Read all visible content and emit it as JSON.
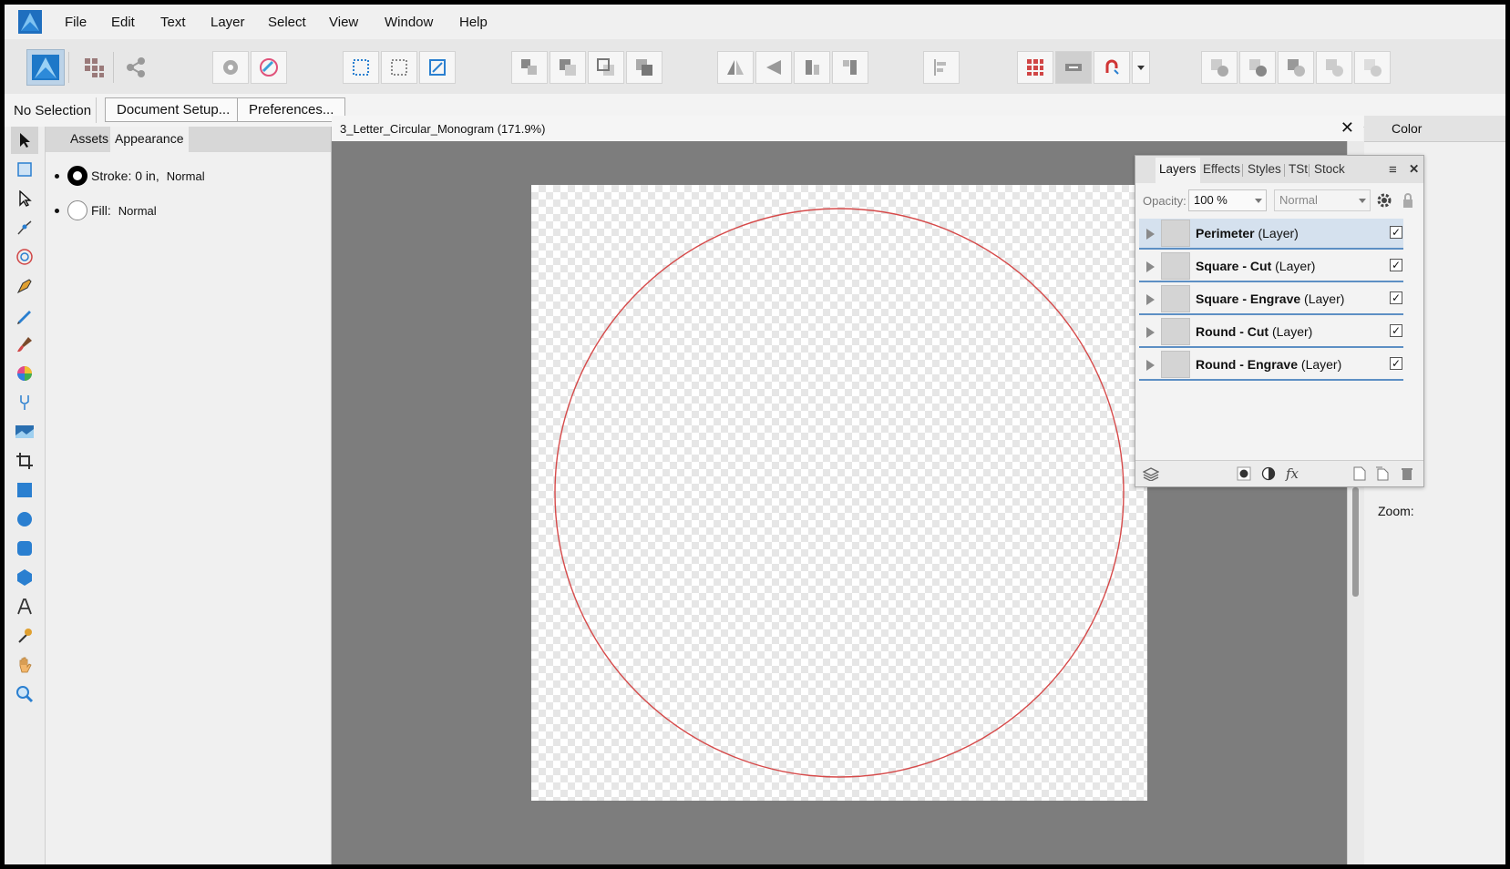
{
  "menu": [
    "File",
    "Edit",
    "Text",
    "Layer",
    "Select",
    "View",
    "Window",
    "Help"
  ],
  "context": {
    "selection_label": "No Selection",
    "document_setup_label": "Document Setup...",
    "preferences_label": "Preferences..."
  },
  "left_panel": {
    "tabs": [
      "Assets",
      "Appearance"
    ],
    "active_tab": "Appearance",
    "stroke_label": "Stroke: 0 in,",
    "stroke_blend": "Normal",
    "fill_label": "Fill:",
    "fill_blend": "Normal"
  },
  "document": {
    "title": "3_Letter_Circular_Monogram (171.9%)",
    "close_glyph": "✕",
    "circle_stroke_color": "#d64a4a"
  },
  "right_panel": {
    "tab_label": "Color",
    "zoom_label": "Zoom:"
  },
  "layers_panel": {
    "tabs": [
      "Layers",
      "Effects",
      "Styles",
      "TSt",
      "Stock"
    ],
    "active_tab": "Layers",
    "opacity_label": "Opacity:",
    "opacity_value": "100 %",
    "blend_mode": "Normal",
    "close_glyph": "✕",
    "menu_glyph": "≡",
    "layers": [
      {
        "name": "Perimeter",
        "type": "(Layer)",
        "visible": true,
        "selected": true
      },
      {
        "name": "Square - Cut",
        "type": "(Layer)",
        "visible": true,
        "selected": false
      },
      {
        "name": "Square - Engrave",
        "type": "(Layer)",
        "visible": true,
        "selected": false
      },
      {
        "name": "Round - Cut",
        "type": "(Layer)",
        "visible": true,
        "selected": false
      },
      {
        "name": "Round - Engrave",
        "type": "(Layer)",
        "visible": true,
        "selected": false
      }
    ],
    "fx_glyph": "fx"
  },
  "colors": {
    "accent_blue": "#5d8fc4",
    "selection_row": "#d5e1ee",
    "canvas_bg": "#7d7d7d"
  }
}
